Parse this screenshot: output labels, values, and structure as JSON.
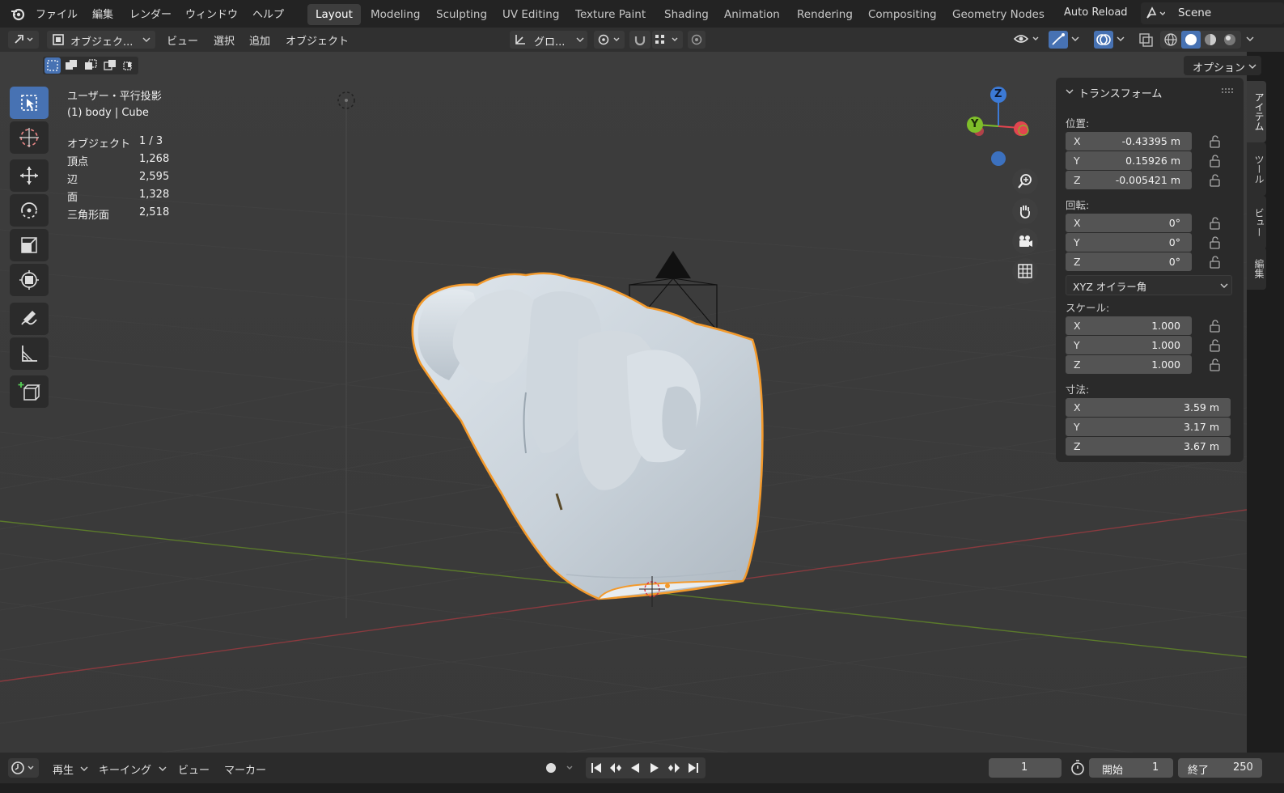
{
  "topbar": {
    "menu": [
      "ファイル",
      "編集",
      "レンダー",
      "ウィンドウ",
      "ヘルプ"
    ],
    "workspaces": [
      "Layout",
      "Modeling",
      "Sculpting",
      "UV Editing",
      "Texture Paint",
      "Shading",
      "Animation",
      "Rendering",
      "Compositing",
      "Geometry Nodes"
    ],
    "active_workspace": "Layout",
    "auto_reload": "Auto Reload",
    "scene": "Scene"
  },
  "header": {
    "mode": "オブジェク...",
    "view": "ビュー",
    "select": "選択",
    "add": "追加",
    "object": "オブジェクト",
    "orientation": "グロ...",
    "options": "オプション"
  },
  "viewport_info": {
    "view_name": "ユーザー・平行投影",
    "object_name": "(1) body | Cube",
    "stats": [
      {
        "label": "オブジェクト",
        "value": "1 / 3"
      },
      {
        "label": "頂点",
        "value": "1,268"
      },
      {
        "label": "辺",
        "value": "2,595"
      },
      {
        "label": "面",
        "value": "1,328"
      },
      {
        "label": "三角形面",
        "value": "2,518"
      }
    ]
  },
  "gizmo": {
    "z": "Z",
    "y": "Y"
  },
  "npanel": {
    "title": "トランスフォーム",
    "location_label": "位置:",
    "location": [
      {
        "axis": "X",
        "value": "-0.43395 m"
      },
      {
        "axis": "Y",
        "value": "0.15926 m"
      },
      {
        "axis": "Z",
        "value": "-0.005421 m"
      }
    ],
    "rotation_label": "回転:",
    "rotation": [
      {
        "axis": "X",
        "value": "0°"
      },
      {
        "axis": "Y",
        "value": "0°"
      },
      {
        "axis": "Z",
        "value": "0°"
      }
    ],
    "rotation_mode": "XYZ オイラー角",
    "scale_label": "スケール:",
    "scale": [
      {
        "axis": "X",
        "value": "1.000"
      },
      {
        "axis": "Y",
        "value": "1.000"
      },
      {
        "axis": "Z",
        "value": "1.000"
      }
    ],
    "dimensions_label": "寸法:",
    "dimensions": [
      {
        "axis": "X",
        "value": "3.59 m"
      },
      {
        "axis": "Y",
        "value": "3.17 m"
      },
      {
        "axis": "Z",
        "value": "3.67 m"
      }
    ]
  },
  "side_tabs": [
    "アイテム",
    "ツール",
    "ビュー",
    "編集"
  ],
  "timeline": {
    "playback": "再生",
    "keying": "キーイング",
    "view": "ビュー",
    "marker": "マーカー",
    "current_frame": "1",
    "start_label": "開始",
    "start": "1",
    "end_label": "終了",
    "end": "250"
  },
  "colors": {
    "selection_outline": "#f39a2c",
    "active_tool": "#4772b3",
    "axis_x": "#e2454f",
    "axis_y": "#7fbe2a",
    "axis_z": "#3c7ad6"
  }
}
